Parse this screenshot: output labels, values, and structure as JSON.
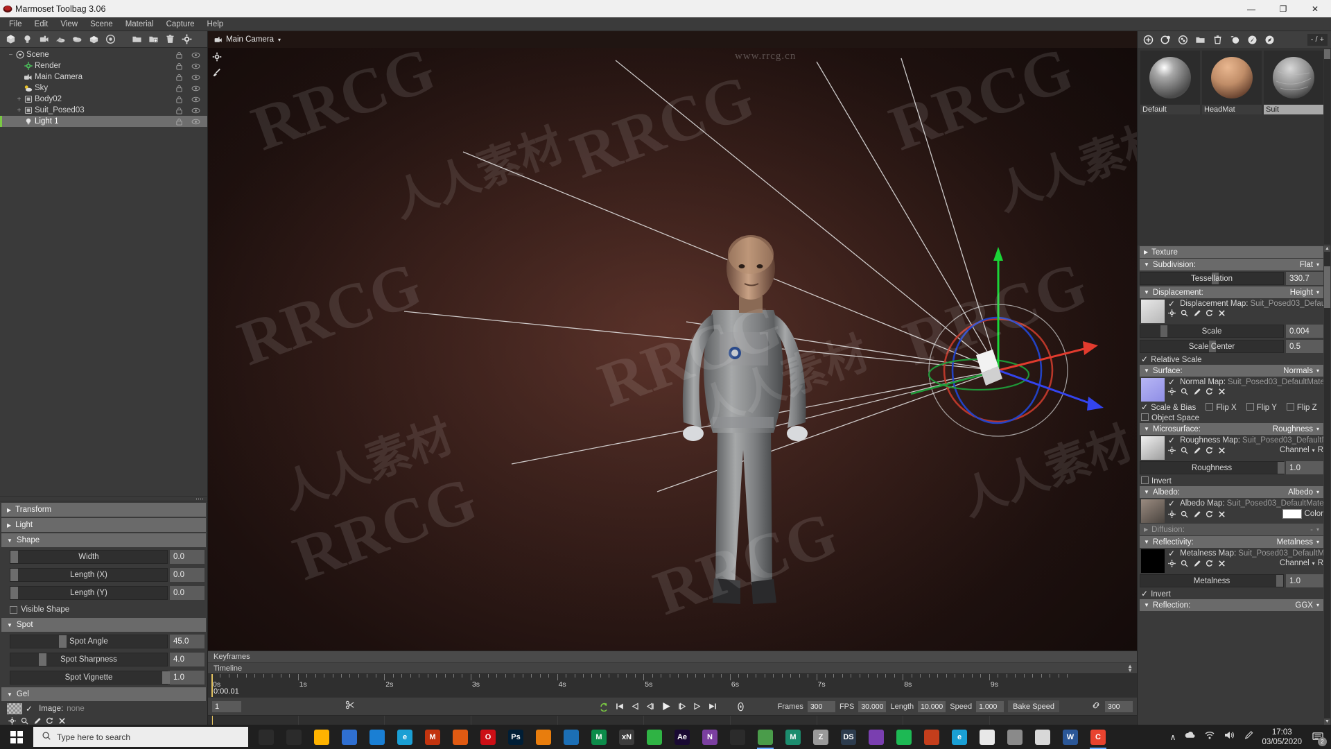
{
  "window": {
    "title": "Marmoset Toolbag 3.06",
    "minimize": "—",
    "maximize": "❐",
    "close": "✕"
  },
  "menubar": {
    "items": [
      "File",
      "Edit",
      "View",
      "Scene",
      "Material",
      "Capture",
      "Help"
    ]
  },
  "left_toolbar": {
    "icons": [
      "mesh-icon",
      "light-icon",
      "camera-icon",
      "sky-icon",
      "fog-icon",
      "object-icon",
      "turntable-icon",
      "folder-icon",
      "add-folder-icon",
      "trash-icon"
    ]
  },
  "scene_tree": {
    "items": [
      {
        "label": "Scene",
        "depth": 0,
        "icon": "scene-icon",
        "expander": "−",
        "selected": false
      },
      {
        "label": "Render",
        "depth": 1,
        "icon": "render-icon",
        "expander": "",
        "selected": false
      },
      {
        "label": "Main Camera",
        "depth": 1,
        "icon": "camera-icon",
        "expander": "",
        "selected": false
      },
      {
        "label": "Sky",
        "depth": 1,
        "icon": "sky-icon",
        "expander": "",
        "selected": false
      },
      {
        "label": "Body02",
        "depth": 1,
        "icon": "mesh-icon",
        "expander": "+",
        "selected": false
      },
      {
        "label": "Suit_Posed03",
        "depth": 1,
        "icon": "mesh-icon",
        "expander": "+",
        "selected": false
      },
      {
        "label": "Light 1",
        "depth": 1,
        "icon": "light-icon",
        "expander": "",
        "selected": true
      }
    ]
  },
  "left_props": {
    "sections": [
      {
        "name": "Transform",
        "open": false
      },
      {
        "name": "Light",
        "open": false
      },
      {
        "name": "Shape",
        "open": true
      },
      {
        "name": "Spot",
        "open": true
      },
      {
        "name": "Gel",
        "open": true
      }
    ],
    "shape": {
      "rows": [
        {
          "label": "Width",
          "value": "0.0",
          "fill": 0
        },
        {
          "label": "Length (X)",
          "value": "0.0",
          "fill": 0
        },
        {
          "label": "Length (Y)",
          "value": "0.0",
          "fill": 0
        }
      ],
      "visible_shape": {
        "label": "Visible Shape",
        "checked": false
      }
    },
    "spot": {
      "rows": [
        {
          "label": "Spot Angle",
          "value": "45.0",
          "fill": 31
        },
        {
          "label": "Spot Sharpness",
          "value": "4.0",
          "fill": 18
        },
        {
          "label": "Spot Vignette",
          "value": "1.0",
          "fill": 97
        }
      ]
    },
    "gel": {
      "image_label": "Image:",
      "image_value": "none",
      "image_checked": true
    }
  },
  "viewport": {
    "camera_label": "Main Camera",
    "caret": "▾",
    "tools": [
      "settings-gear-icon",
      "paint-brush-icon"
    ],
    "watermark_url": "www.rrcg.cn"
  },
  "timeline": {
    "keyframes_label": "Keyframes",
    "timeline_label": "Timeline",
    "current_time": "0:00.01",
    "frame_value": "1",
    "ruler_labels": [
      "0s",
      "1s",
      "2s",
      "3s",
      "4s",
      "5s",
      "6s",
      "7s",
      "8s",
      "9s"
    ],
    "transport_icons": [
      "loop-icon",
      "skip-start-icon",
      "prev-keyframe-icon",
      "step-back-icon",
      "play-icon",
      "step-forward-icon",
      "next-keyframe-icon",
      "skip-end-icon",
      "record-icon"
    ],
    "fields": [
      {
        "label": "Frames",
        "value": "300"
      },
      {
        "label": "FPS",
        "value": "30.000"
      },
      {
        "label": "Length",
        "value": "10.000"
      },
      {
        "label": "Speed",
        "value": "1.000"
      }
    ],
    "bake_speed_label": "Bake Speed",
    "link_value": "300"
  },
  "materials": {
    "toolbar_icons": [
      "add-material-icon",
      "duplicate-material-icon",
      "checker-icon",
      "folder-icon",
      "trash-icon",
      "pick-material-icon",
      "assign-material-icon",
      "browse-material-icon"
    ],
    "counter": "- / +",
    "items": [
      {
        "name": "Default",
        "selected": false
      },
      {
        "name": "HeadMat",
        "selected": false
      },
      {
        "name": "Suit",
        "selected": true
      }
    ]
  },
  "material_props": {
    "texture": {
      "title": "Texture",
      "open": false
    },
    "subdivision": {
      "title": "Subdivision:",
      "value": "Flat",
      "open": true,
      "tessellation": {
        "label": "Tessellation",
        "value": "330.7",
        "fill": 50
      }
    },
    "displacement": {
      "title": "Displacement:",
      "value": "Height",
      "open": true,
      "map_label": "Displacement Map:",
      "map_file": "Suit_Posed03_Defaul",
      "map_checked": true,
      "rows": [
        {
          "label": "Scale",
          "value": "0.004",
          "fill": 14
        },
        {
          "label": "Scale Center",
          "value": "0.5",
          "fill": 48
        }
      ],
      "relative_scale": {
        "label": "Relative Scale",
        "checked": true
      }
    },
    "surface": {
      "title": "Surface:",
      "value": "Normals",
      "open": true,
      "map_label": "Normal Map:",
      "map_file": "Suit_Posed03_DefaultMate",
      "map_checked": true,
      "checks": [
        {
          "label": "Scale & Bias",
          "checked": true
        },
        {
          "label": "Flip X",
          "checked": false
        },
        {
          "label": "Flip Y",
          "checked": false
        },
        {
          "label": "Flip Z",
          "checked": false
        }
      ],
      "object_space": {
        "label": "Object Space",
        "checked": false
      }
    },
    "microsurface": {
      "title": "Microsurface:",
      "value": "Roughness",
      "open": true,
      "map_label": "Roughness Map:",
      "map_file": "Suit_Posed03_DefaultM",
      "map_checked": true,
      "channel_label": "Channel",
      "channel_value": "R",
      "row": {
        "label": "Roughness",
        "value": "1.0",
        "fill": 96
      },
      "invert": {
        "label": "Invert",
        "checked": false
      }
    },
    "albedo": {
      "title": "Albedo:",
      "value": "Albedo",
      "open": true,
      "map_label": "Albedo Map:",
      "map_file": "Suit_Posed03_DefaultMater",
      "map_checked": true,
      "color_label": "Color",
      "color_hex": "#ffffff"
    },
    "diffusion": {
      "title": "Diffusion:",
      "value": "-",
      "open": false
    },
    "reflectivity": {
      "title": "Reflectivity:",
      "value": "Metalness",
      "open": true,
      "map_label": "Metalness Map:",
      "map_file": "Suit_Posed03_DefaultMa",
      "map_checked": true,
      "channel_label": "Channel",
      "channel_value": "R",
      "row": {
        "label": "Metalness",
        "value": "1.0",
        "fill": 95
      },
      "invert": {
        "label": "Invert",
        "checked": true
      }
    },
    "reflection": {
      "title": "Reflection:",
      "value": "GGX",
      "open": true
    }
  },
  "taskbar": {
    "search_placeholder": "Type here to search",
    "icons": [
      {
        "name": "cortana-icon",
        "glyph": "○",
        "color": "#2b2b2b",
        "text": ""
      },
      {
        "name": "task-view-icon",
        "glyph": "▣",
        "color": "#2b2b2b",
        "text": ""
      },
      {
        "name": "file-explorer-icon",
        "glyph": "",
        "color": "#ffb300",
        "text": ""
      },
      {
        "name": "store-icon",
        "glyph": "",
        "color": "#2f6fd0",
        "text": ""
      },
      {
        "name": "mail-icon",
        "glyph": "",
        "color": "#1a7fd4",
        "text": ""
      },
      {
        "name": "edge-icon",
        "glyph": "e",
        "color": "#1a9fd4",
        "text": "e"
      },
      {
        "name": "app-m-icon",
        "glyph": "M",
        "color": "#c2340f",
        "text": "M"
      },
      {
        "name": "firefox-icon",
        "glyph": "",
        "color": "#e05a12",
        "text": ""
      },
      {
        "name": "opera-icon",
        "glyph": "O",
        "color": "#cc0f16",
        "text": "O"
      },
      {
        "name": "photoshop-icon",
        "glyph": "Ps",
        "color": "#001e36",
        "text": "Ps"
      },
      {
        "name": "blender-icon",
        "glyph": "",
        "color": "#e87d0d",
        "text": ""
      },
      {
        "name": "marmoset-icon",
        "glyph": "",
        "color": "#1c6fb5",
        "text": ""
      },
      {
        "name": "maya-icon",
        "glyph": "M",
        "color": "#0c8c4a",
        "text": "M"
      },
      {
        "name": "xn-icon",
        "glyph": "xN",
        "color": "#3c3c3c",
        "text": "xN"
      },
      {
        "name": "note-icon",
        "glyph": "",
        "color": "#2fb344",
        "text": ""
      },
      {
        "name": "after-effects-icon",
        "glyph": "Ae",
        "color": "#1a0a33",
        "text": "Ae"
      },
      {
        "name": "onenote-icon",
        "glyph": "N",
        "color": "#7b3fa0",
        "text": "N"
      },
      {
        "name": "substance-icon",
        "glyph": "",
        "color": "#2b2b2b",
        "text": ""
      },
      {
        "name": "marmoset2-icon",
        "glyph": "",
        "color": "#4a9c4a",
        "text": ""
      },
      {
        "name": "3dsmax-icon",
        "glyph": "M",
        "color": "#1c8c6e",
        "text": "M"
      },
      {
        "name": "zbrush-icon",
        "glyph": "Z",
        "color": "#9a9a9a",
        "text": "Z"
      },
      {
        "name": "designer-icon",
        "glyph": "DS",
        "color": "#2d3c4e",
        "text": "DS"
      },
      {
        "name": "photo-icon",
        "glyph": "",
        "color": "#7a3fb0",
        "text": ""
      },
      {
        "name": "spotify-icon",
        "glyph": "",
        "color": "#1db954",
        "text": ""
      },
      {
        "name": "excel-icon",
        "glyph": "",
        "color": "#c43e1c",
        "text": ""
      },
      {
        "name": "edge2-icon",
        "glyph": "e",
        "color": "#1a9fd4",
        "text": "e"
      },
      {
        "name": "chrome-icon",
        "glyph": "",
        "color": "#e8e8e8",
        "text": ""
      },
      {
        "name": "snipping-icon",
        "glyph": "",
        "color": "#8a8a8a",
        "text": ""
      },
      {
        "name": "clock-icon",
        "glyph": "",
        "color": "#d8d8d8",
        "text": ""
      },
      {
        "name": "word-icon",
        "glyph": "W",
        "color": "#2b5797",
        "text": "W"
      },
      {
        "name": "camtasia-icon",
        "glyph": "C",
        "color": "#e8432f",
        "text": "C"
      }
    ],
    "tray": {
      "chevron": "∧",
      "icons": [
        "onedrive-icon",
        "wifi-icon",
        "volume-icon",
        "pen-icon"
      ],
      "time": "17:03",
      "date": "03/05/2020",
      "notification_count": "2"
    }
  },
  "watermarks": {
    "latin": "RRCG",
    "chinese": "人人素材"
  }
}
